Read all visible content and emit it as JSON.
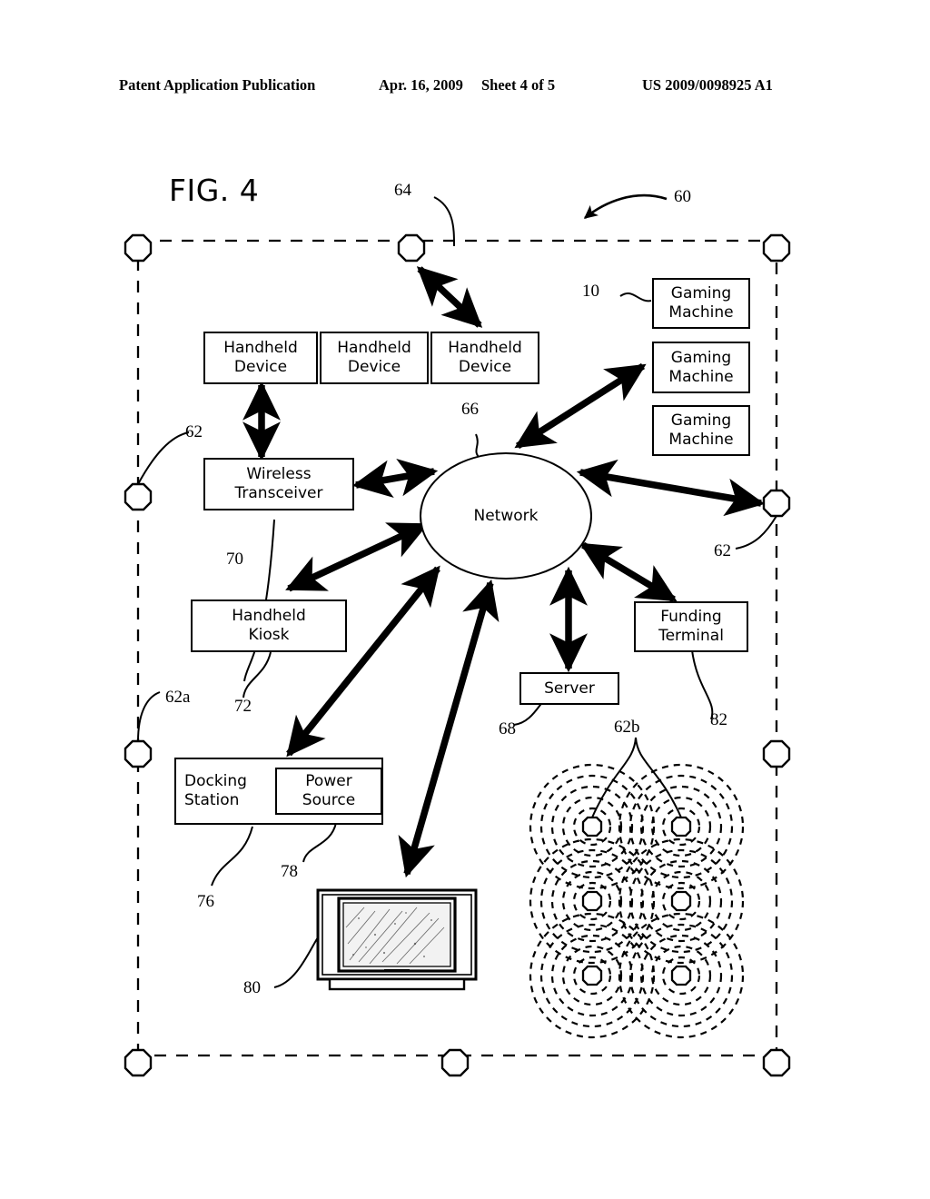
{
  "header": {
    "publication": "Patent Application Publication",
    "date": "Apr. 16, 2009",
    "sheet": "Sheet 4 of 5",
    "patent_number": "US 2009/0098925 A1"
  },
  "figure": {
    "title": "FIG. 4",
    "system_label": "60"
  },
  "nodes": {
    "handheld_device_1": "Handheld\nDevice",
    "handheld_device_2": "Handheld\nDevice",
    "handheld_device_3": "Handheld\nDevice",
    "gaming_machine_1": "Gaming\nMachine",
    "gaming_machine_2": "Gaming\nMachine",
    "gaming_machine_3": "Gaming\nMachine",
    "wireless_transceiver": "Wireless\nTransceiver",
    "network": "Network",
    "handheld_kiosk": "Handheld\nKiosk",
    "docking_station": "Docking\nStation",
    "power_source": "Power\nSource",
    "server": "Server",
    "funding_terminal": "Funding\nTerminal"
  },
  "reference_numerals": {
    "gaming_machine": "10",
    "system": "60",
    "boundary_node_left": "62",
    "boundary_node_right": "62",
    "boundary_node_lower_left": "62a",
    "cell_array": "62b",
    "top_boundary_node": "64",
    "network": "66",
    "server": "68",
    "wireless_transceiver": "70",
    "handheld_kiosk": "72",
    "docking_station": "76",
    "power_source": "78",
    "television": "80",
    "funding_terminal": "82"
  },
  "colors": {
    "ink": "#000000",
    "paper": "#ffffff"
  },
  "icons": {
    "boundary_node": "octagon-icon",
    "television": "crt-television-icon",
    "cell_coverage": "concentric-dashed-circles-icon"
  }
}
